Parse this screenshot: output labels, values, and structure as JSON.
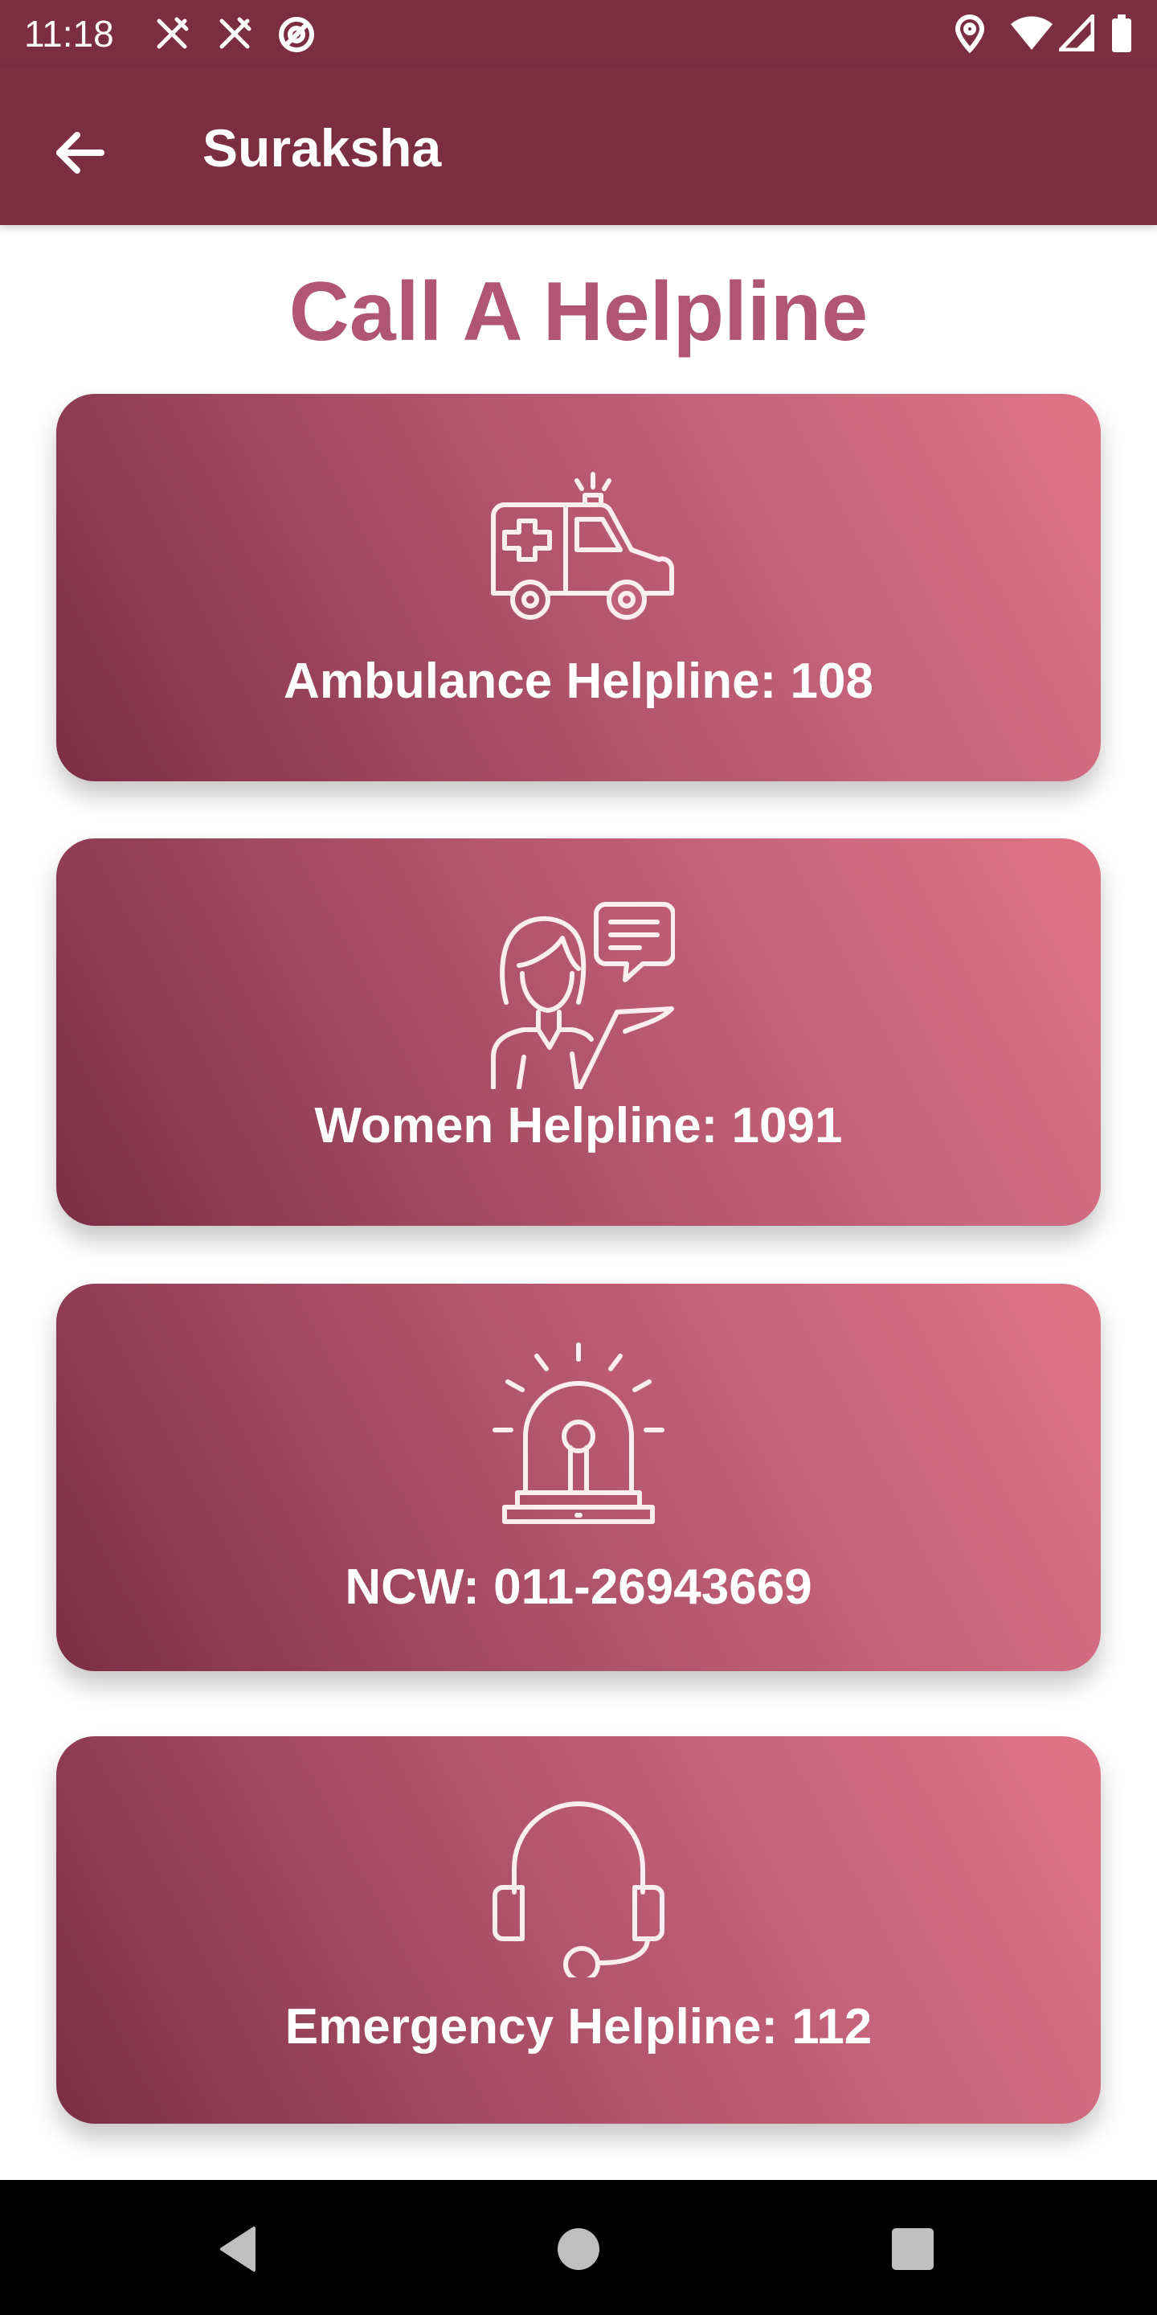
{
  "status_bar": {
    "time": "11:18",
    "left_icons": [
      "fork-knife-icon",
      "fork-knife-icon",
      "no-signal-circle-icon"
    ],
    "right_icons": [
      "location-pin-icon",
      "wifi-icon",
      "cell-signal-icon",
      "battery-icon"
    ]
  },
  "app_bar": {
    "title": "Suraksha",
    "back_icon": "arrow-left-icon",
    "color": "#7b2d42"
  },
  "page": {
    "title": "Call A Helpline",
    "title_color": "#b05573"
  },
  "helplines": [
    {
      "label": "Ambulance Helpline: 108",
      "icon": "ambulance-icon"
    },
    {
      "label": "Women Helpline: 1091",
      "icon": "woman-support-icon"
    },
    {
      "label": "NCW: 011-26943669",
      "icon": "siren-icon"
    },
    {
      "label": "Emergency Helpline: 112",
      "icon": "headset-icon"
    }
  ],
  "card_gradient": [
    "#7c2e45",
    "#e07486"
  ],
  "nav_bar": {
    "buttons": [
      "back-triangle-icon",
      "home-circle-icon",
      "recents-square-icon"
    ]
  }
}
